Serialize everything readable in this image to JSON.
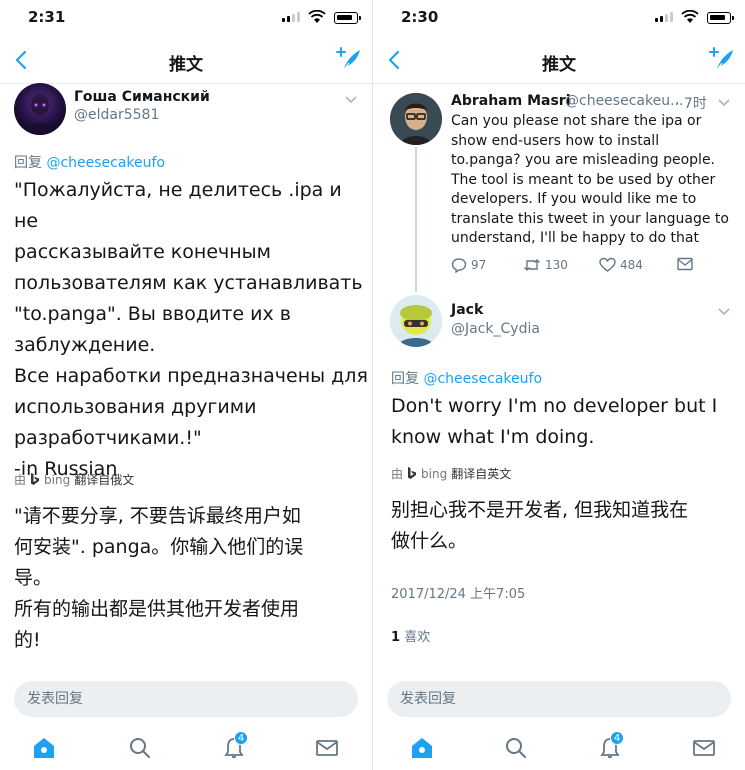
{
  "left": {
    "status": {
      "time": "2:31"
    },
    "nav": {
      "title": "推文"
    },
    "author": {
      "name": "Гоша Симанский",
      "handle": "@eldar5581"
    },
    "reply_prefix": "回复",
    "reply_to": "@cheesecakeufo",
    "body_lines": [
      "\"Пожалуйста, не делитесь .ipa и не",
      "рассказывайте конечным",
      "пользователям как устанавливать",
      "\"to.panga\". Вы вводите их в",
      "заблуждение.",
      "Все наработки предназначены для",
      "использования другими",
      "разработчиками.!\"",
      "-in Russian"
    ],
    "translate": {
      "by": "由",
      "brand": "bing",
      "label": "翻译自俄文"
    },
    "translated_lines": [
      "\"请不要分享, 不要告诉最终用户如",
      "何安装\". panga。你输入他们的误",
      "导。",
      "所有的输出都是供其他开发者使用",
      "的!"
    ],
    "reply_placeholder": "发表回复",
    "notifications_badge": "4"
  },
  "right": {
    "status": {
      "time": "2:30"
    },
    "nav": {
      "title": "推文"
    },
    "parent": {
      "name": "Abraham Masri",
      "handle": "@cheesecakeu...",
      "time": "· 7时",
      "text_lines": [
        "Can you please not share the ipa or",
        "show end-users how to install",
        "to.panga? you are misleading people.",
        "The tool is meant to be used by other",
        "developers. If you would like me to",
        "translate this tweet in your language to",
        "understand, I'll be happy to do that"
      ],
      "replies": "97",
      "retweets": "130",
      "likes": "484"
    },
    "author": {
      "name": "Jack",
      "handle": "@Jack_Cydia"
    },
    "reply_prefix": "回复",
    "reply_to": "@cheesecakeufo",
    "body_lines": [
      "Don't worry I'm no developer but I",
      "know what I'm doing."
    ],
    "translate": {
      "by": "由",
      "brand": "bing",
      "label": "翻译自英文"
    },
    "translated_lines": [
      "别担心我不是开发者, 但我知道我在",
      "做什么。"
    ],
    "timestamp": "2017/12/24 上午7:05",
    "like_count": "1",
    "like_label": "喜欢",
    "reply_placeholder": "发表回复",
    "notifications_badge": "4"
  },
  "colors": {
    "accent": "#1da1f2",
    "text": "#14171a",
    "muted": "#657786",
    "input_bg": "#eceff1"
  },
  "icons": [
    "back-arrow-icon",
    "compose-tweet-icon",
    "chevron-down-icon",
    "bing-logo-icon",
    "reply-icon",
    "retweet-icon",
    "like-icon",
    "share-icon",
    "home-icon",
    "search-icon",
    "notifications-icon",
    "messages-icon"
  ]
}
